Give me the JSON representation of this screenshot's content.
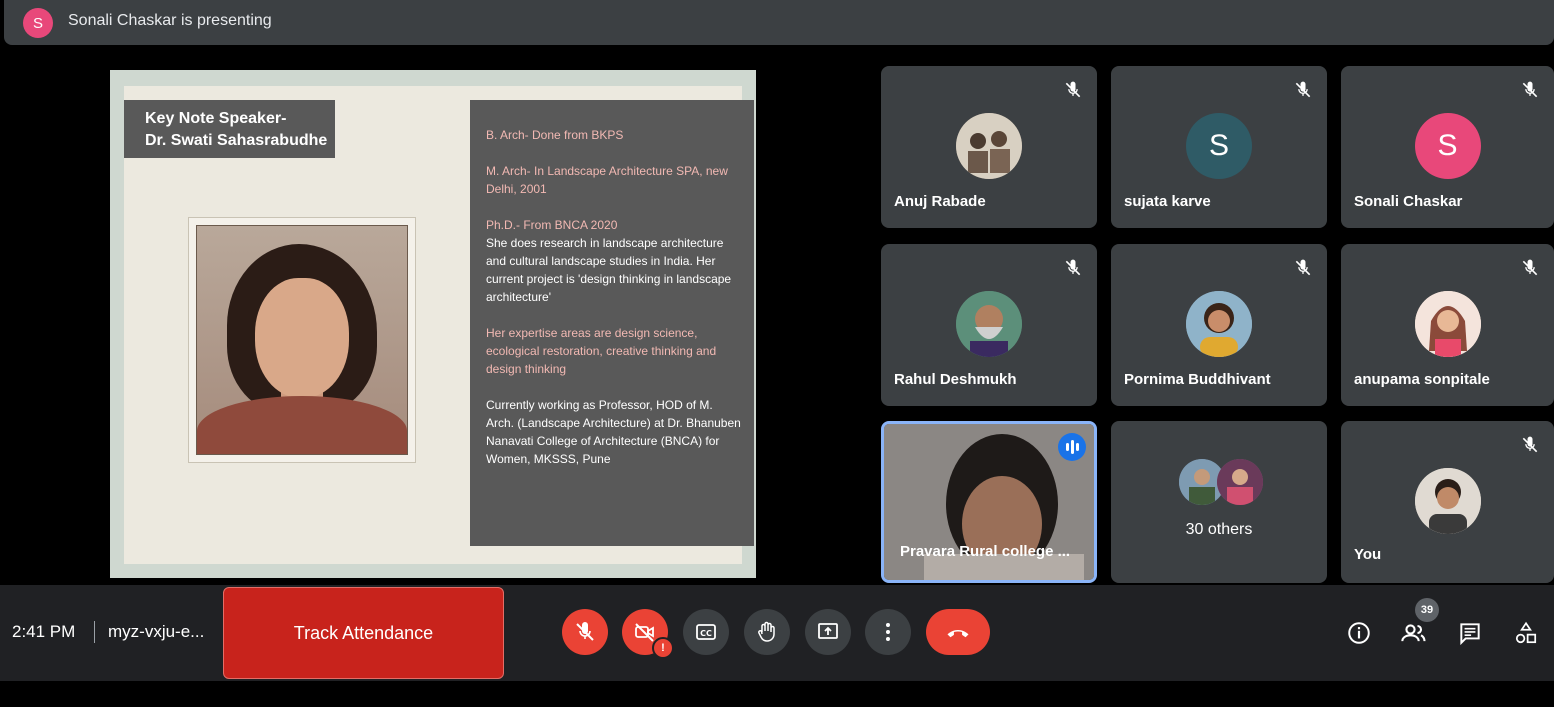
{
  "topbar": {
    "presenter_initial": "S",
    "presenting_text": "Sonali Chaskar is presenting"
  },
  "slide": {
    "speaker_title_line1": "Key Note Speaker-",
    "speaker_title_line2": "Dr. Swati Sahasrabudhe",
    "info": {
      "p1": "B. Arch- Done from BKPS",
      "p2": "M. Arch- In Landscape Architecture SPA, new Delhi, 2001",
      "p3a": "Ph.D.- From BNCA 2020",
      "p3b": "She does research in landscape architecture and cultural landscape studies in India. Her current project is 'design thinking in landscape architecture'",
      "p4": "Her expertise areas are design science, ecological restoration, creative thinking and design thinking",
      "p5": "Currently working as Professor, HOD of M. Arch. (Landscape Architecture) at  Dr. Bhanuben Nanavati College of Architecture (BNCA) for Women, MKSSS, Pune"
    }
  },
  "participants": [
    {
      "name": "Anuj Rabade",
      "initial": "",
      "muted": true
    },
    {
      "name": "sujata karve",
      "initial": "S",
      "color": "#2f5b66",
      "muted": true
    },
    {
      "name": "Sonali Chaskar",
      "initial": "S",
      "color": "#e8487a",
      "muted": true
    },
    {
      "name": "Rahul Deshmukh",
      "initial": "",
      "muted": true
    },
    {
      "name": "Pornima Buddhivant",
      "initial": "",
      "muted": true
    },
    {
      "name": "anupama sonpitale",
      "initial": "",
      "muted": true
    },
    {
      "name": "Pravara Rural college ...",
      "initial": "",
      "muted": false,
      "speaking": true
    },
    {
      "name": "30 others",
      "initial": "",
      "muted": false
    },
    {
      "name": "You",
      "initial": "",
      "muted": true
    }
  ],
  "bottombar": {
    "time": "2:41 PM",
    "meeting_code": "myz-vxju-e...",
    "track_label": "Track Attendance",
    "people_count": "39"
  }
}
